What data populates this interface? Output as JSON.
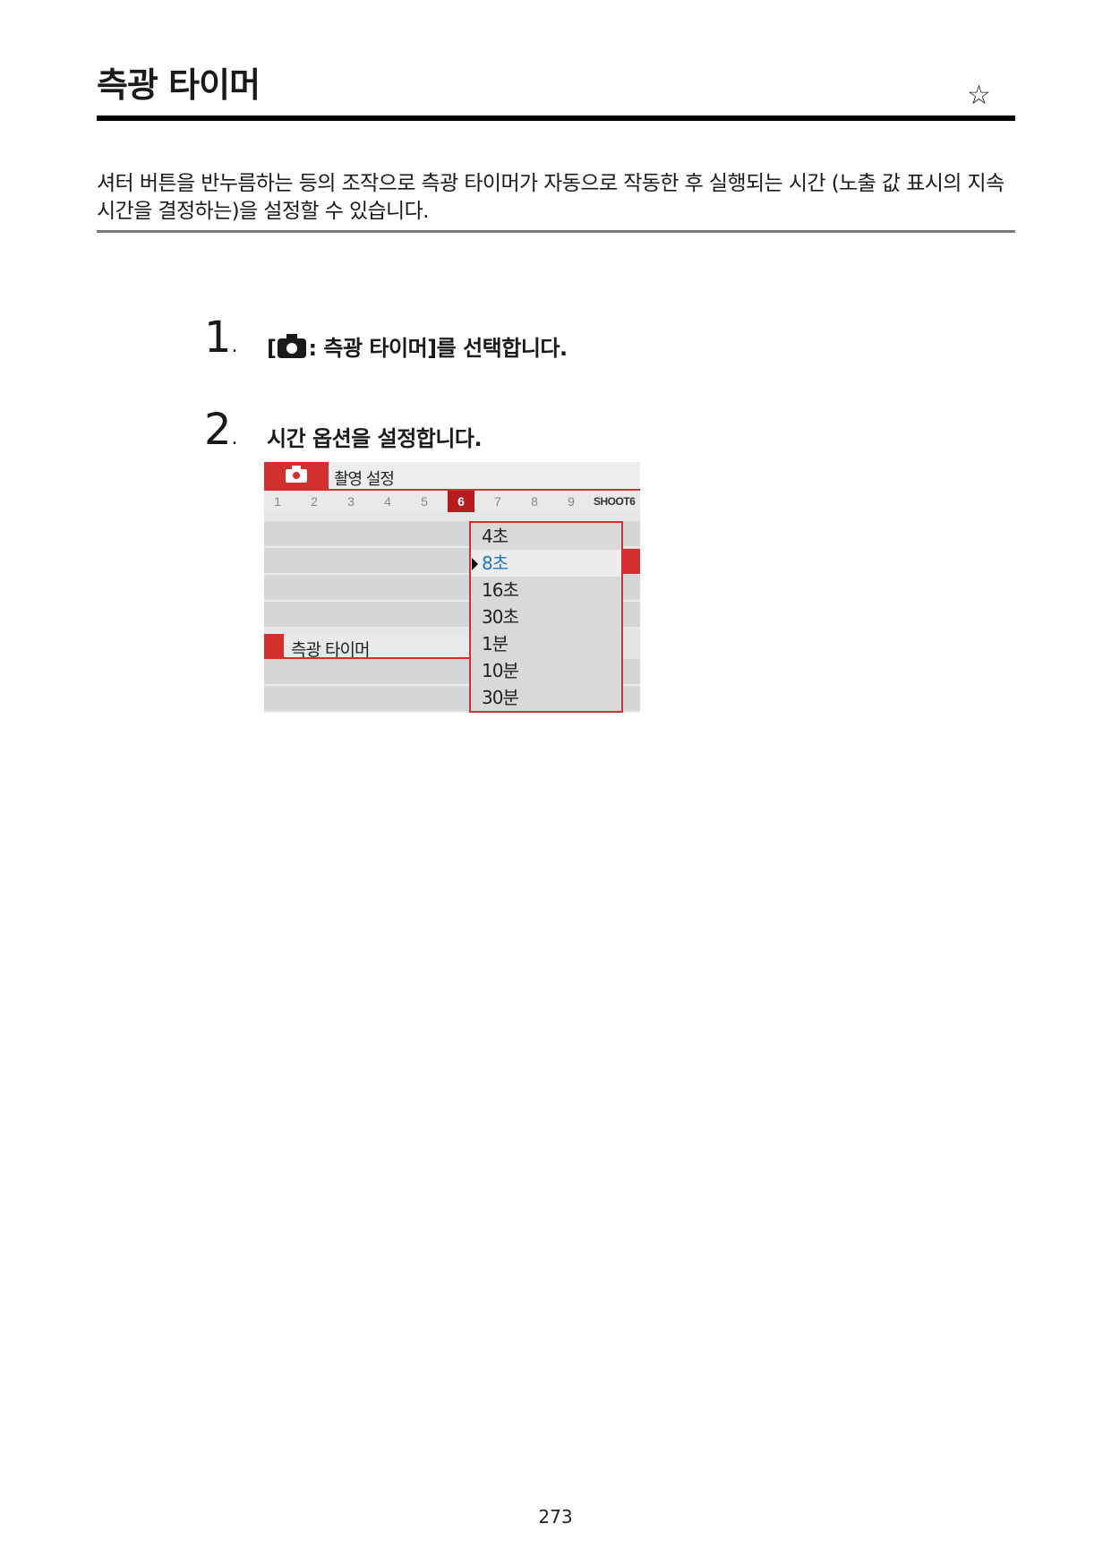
{
  "header": {
    "title": "측광 타이머",
    "star": "☆"
  },
  "intro": "셔터 버튼을 반누름하는 등의 조작으로 측광 타이머가 자동으로 작동한 후 실행되는 시간 (노출 값 표시의 지속 시간을 결정하는)을 설정할 수 있습니다.",
  "steps": [
    {
      "number": "1",
      "dot": ".",
      "pre": "[",
      "icon": "camera-icon",
      "text": ": 측광 타이머]를 선택합니다."
    },
    {
      "number": "2",
      "dot": ".",
      "text": "시간 옵션을 설정합니다."
    }
  ],
  "screen": {
    "tab_icon": "camera-icon",
    "title": "촬영 설정",
    "tabs": [
      "1",
      "2",
      "3",
      "4",
      "5",
      "6",
      "7",
      "8",
      "9"
    ],
    "active_tab": "6",
    "shoot_label": "SHOOT6",
    "selected_item": "측광 타이머",
    "options": [
      "4초",
      "8초",
      "16초",
      "30초",
      "1분",
      "10분",
      "30분"
    ],
    "current_option": "8초",
    "colors": {
      "accent": "#d32f2f",
      "current_text": "#1f78b4"
    }
  },
  "footer": {
    "page_number": "273"
  }
}
